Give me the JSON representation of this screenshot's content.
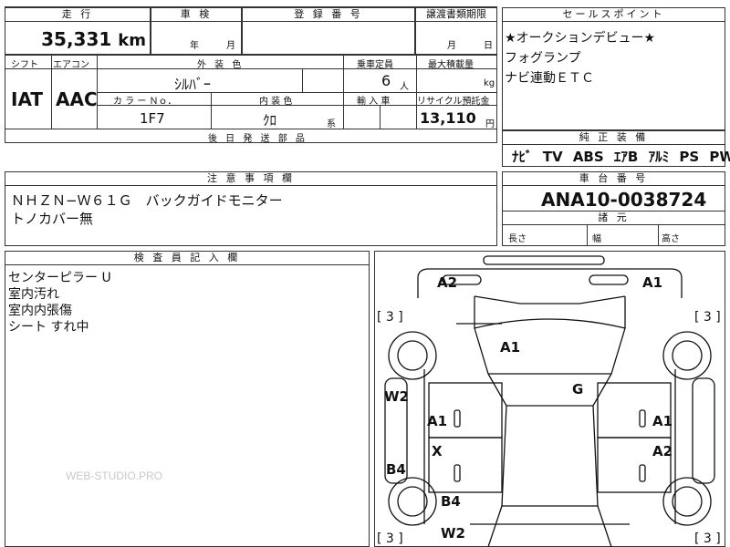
{
  "mileage": {
    "header": "走 行",
    "value": "35,331",
    "unit": "km"
  },
  "inspection": {
    "header": "車 検",
    "year_label": "年",
    "month_label": "月"
  },
  "registration": {
    "header": "登 録 番 号"
  },
  "transfer_period": {
    "header": "譲渡書類期限",
    "month_label": "月",
    "day_label": "日"
  },
  "sales_points": {
    "header": "セールスポイント",
    "lines": [
      "★オークションデビュー★",
      "フォグランプ",
      "ナビ連動ＥＴＣ"
    ]
  },
  "shift": {
    "header": "シフト",
    "value": "IAT"
  },
  "aircon": {
    "header": "エアコン",
    "value": "AAC"
  },
  "exterior_color": {
    "header": "外 装 色",
    "value": "ｼﾙﾊﾞｰ"
  },
  "capacity": {
    "header": "乗車定員",
    "value": "6",
    "unit": "人"
  },
  "max_load": {
    "header": "最大積載量",
    "unit": "kg"
  },
  "color_no": {
    "header": "カ ラ ー Ｎｏ．",
    "value": "1F7"
  },
  "interior_color": {
    "header": "内 装 色",
    "value": "ｸﾛ",
    "suffix": "系"
  },
  "import": {
    "header": "輸 入 車"
  },
  "recycle": {
    "header": "リサイクル預託金",
    "value": "13,110",
    "unit": "円"
  },
  "later_parts": {
    "header": "後 日 発 送 部 品"
  },
  "standard_equipment": {
    "header": "純 正 装 備",
    "items": [
      "ﾅﾋﾞ",
      "TV",
      "ABS",
      "ｴｱB",
      "ｱﾙﾐ",
      "PS",
      "PW"
    ]
  },
  "notes": {
    "header": "注 意 事 項 欄",
    "line1": "ＮＨＺＮ−Ｗ６１Ｇ　バックガイドモニター",
    "line2": "トノカバー無"
  },
  "chassis": {
    "header": "車 台 番 号",
    "value": "ANA10-0038724"
  },
  "specs": {
    "header": "諸 元",
    "length_label": "長さ",
    "width_label": "幅",
    "height_label": "高さ"
  },
  "inspector": {
    "header": "検 査 員 記 入 欄",
    "lines": [
      "センターピラー U",
      "室内汚れ",
      "室内内張傷",
      "シート すれ中"
    ]
  },
  "watermark": "WEB-STUDIO.PRO",
  "damage_map": {
    "top_left": "A2",
    "top_right": "A1",
    "hood": "A1",
    "roof": "G",
    "left_front_fender": "W2",
    "left_front_door": "A1",
    "left_rear_door": "X",
    "left_rear": "B4",
    "rear_center_1": "B4",
    "rear_center_2": "W2",
    "right_front_door": "A1",
    "right_rear_door": "A2",
    "tire_left_front": "[ 3 ]",
    "tire_right_front": "[ 3 ]",
    "tire_left_rear": "[ 3 ]",
    "tire_right_rear": "[ 3 ]"
  }
}
